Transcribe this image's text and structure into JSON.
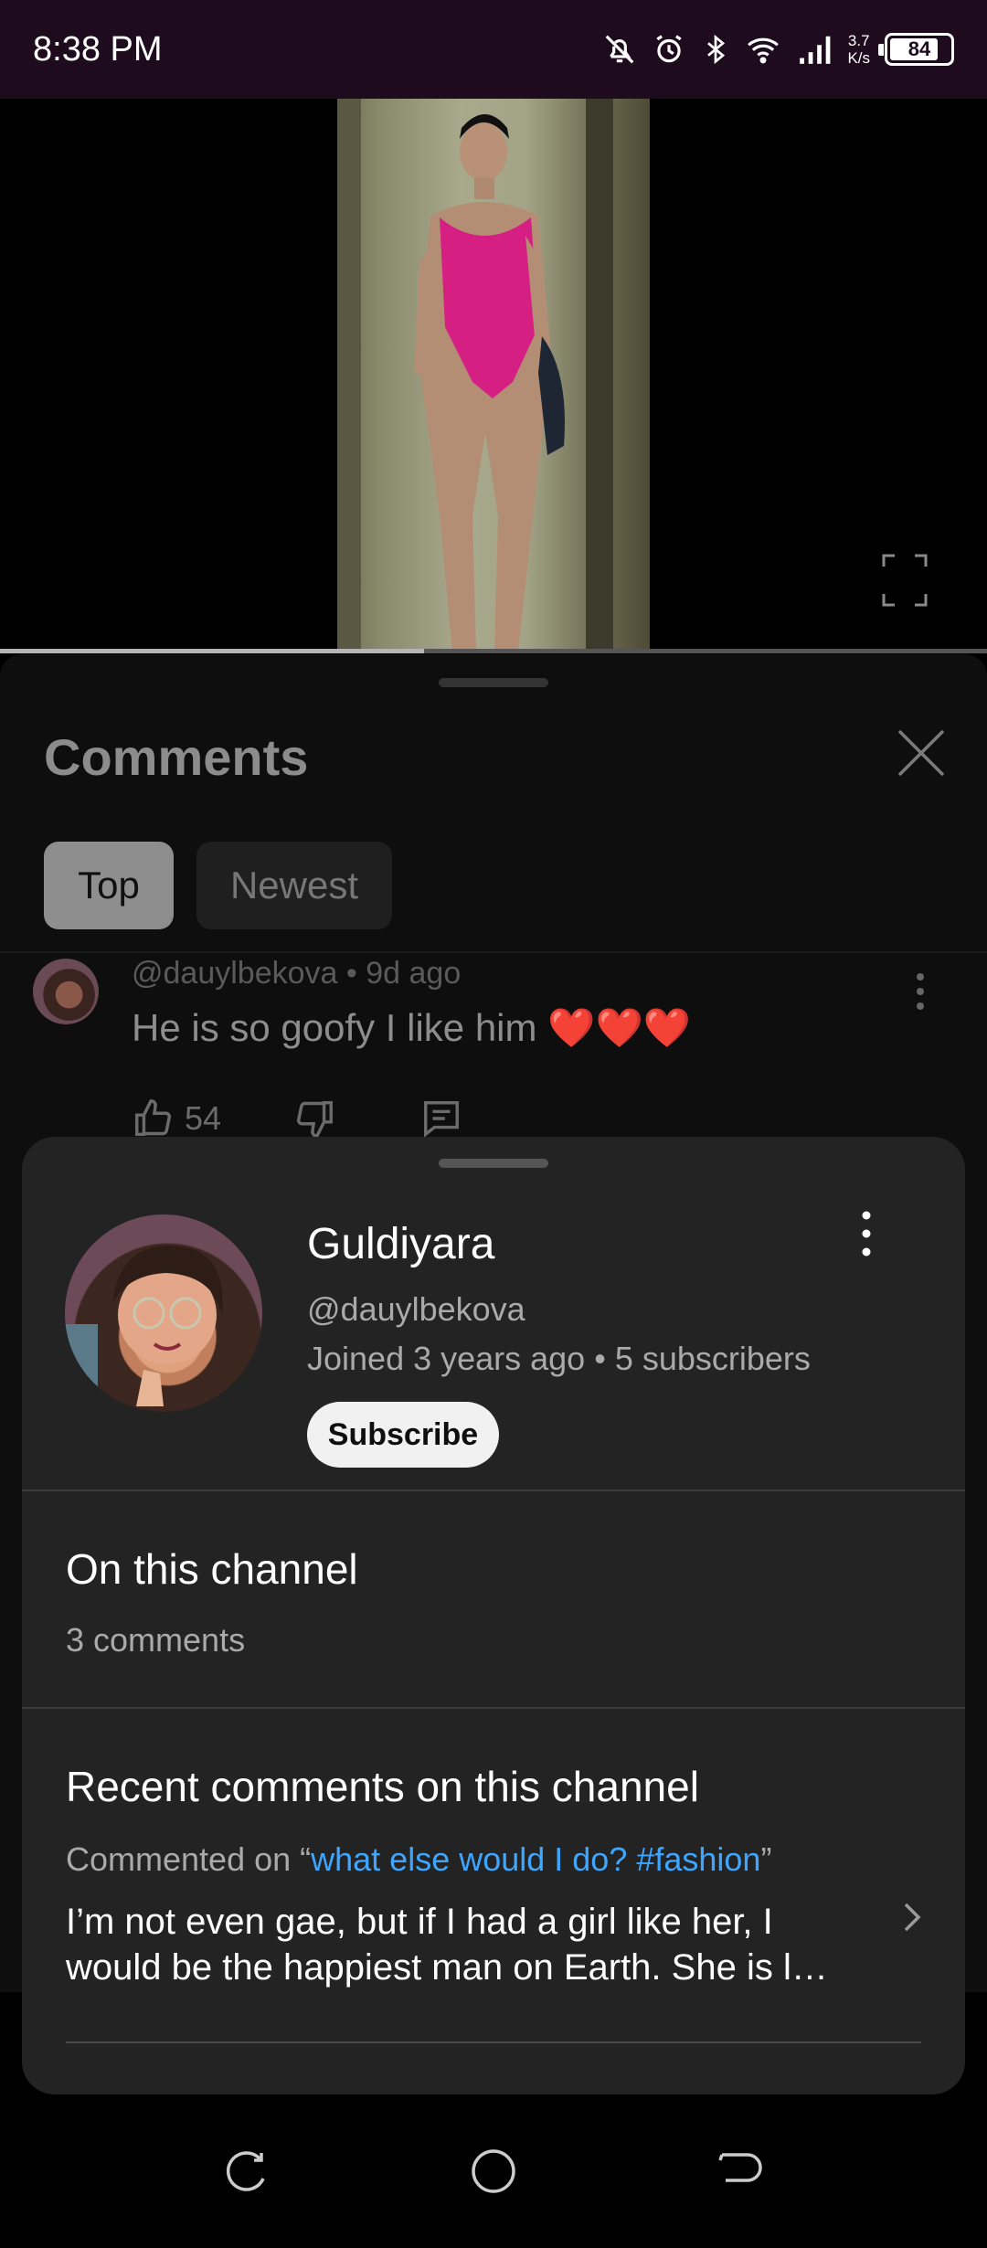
{
  "status_bar": {
    "time": "8:38 PM",
    "net_speed_value": "3.7",
    "net_speed_unit": "K/s",
    "battery": "84"
  },
  "video": {
    "progress": 0.43
  },
  "comments": {
    "title": "Comments",
    "filters": [
      "Top",
      "Newest"
    ],
    "selected_filter": "Top",
    "comment": {
      "author": "@dauylbekova",
      "age": "9d ago",
      "text": "He is so goofy I like him ❤️❤️❤️",
      "likes": "54"
    }
  },
  "channel_card": {
    "name": "Guldiyara",
    "handle": "@dauylbekova",
    "stats": "Joined 3 years ago • 5 subscribers",
    "subscribe_label": "Subscribe",
    "on_channel": {
      "title": "On this channel",
      "count": "3 comments"
    },
    "recent": {
      "title": "Recent comments on this channel",
      "commented_on_prefix": "Commented on “",
      "video_title": "what else would I do? #fashion",
      "commented_on_suffix": "”",
      "text": "I’m not even gae, but if I had a girl like her, I would be the happiest man on Earth. She is l…"
    }
  },
  "colors": {
    "status_bar_bg": "#1e0c1e",
    "link": "#3ea6ff",
    "card_bg": "#232323"
  },
  "icons": [
    "mute-icon",
    "alarm-icon",
    "bluetooth-icon",
    "wifi-icon",
    "signal-icon",
    "fullscreen-icon",
    "close-icon",
    "like-icon",
    "dislike-icon",
    "reply-icon",
    "more-vert-icon",
    "chevron-right-icon",
    "recents-icon",
    "home-icon",
    "back-icon"
  ]
}
